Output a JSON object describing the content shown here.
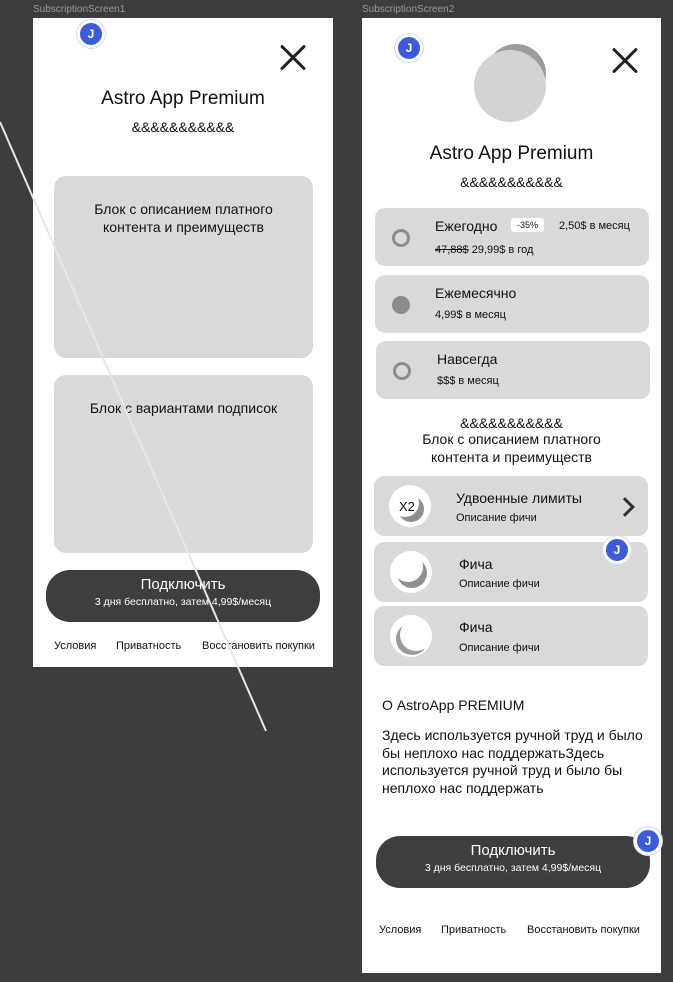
{
  "screen1": {
    "label": "SubscriptionScreen1",
    "avatar": "J",
    "title": "Astro App Premium",
    "subtitle": "&&&&&&&&&&&",
    "block_benefits": "Блок с описанием платного контента и преимуществ",
    "block_plans": "Блок с вариантами подписок",
    "cta": {
      "label": "Подключить",
      "sub": "3 дня бесплатно, затем 4,99$/месяц"
    },
    "footer": {
      "terms": "Условия",
      "privacy": "Приватность",
      "restore": "Восстановить покупки"
    }
  },
  "screen2": {
    "label": "SubscriptionScreen2",
    "avatar": "J",
    "title": "Astro App Premium",
    "subtitle": "&&&&&&&&&&&",
    "plans": [
      {
        "name": "Ежегодно",
        "badge": "-35%",
        "right": "2,50$ в месяц",
        "old_price": "47,88$",
        "price": "29,99$ в год",
        "selected": false
      },
      {
        "name": "Ежемесячно",
        "price": "4,99$ в месяц",
        "selected": true
      },
      {
        "name": "Навсегда",
        "price": "$$$ в месяц",
        "selected": false
      }
    ],
    "benefits_header": "&&&&&&&&&&&",
    "benefits_text": "Блок с описанием платного контента и преимуществ",
    "features": [
      {
        "icon_text": "X2",
        "title": "Удвоенные лимиты",
        "desc": "Описание фичи"
      },
      {
        "title": "Фича",
        "desc": "Описание фичи"
      },
      {
        "title": "Фича",
        "desc": "Описание фичи"
      }
    ],
    "about_title": "О AstroApp PREMIUM",
    "about_text": "Здесь используется ручной труд и было бы неплохо нас поддержатьЗдесь используется ручной труд и было бы неплохо нас поддержать",
    "cta": {
      "label": "Подключить",
      "sub": "3 дня бесплатно, затем 4,99$/месяц"
    },
    "footer": {
      "terms": "Условия",
      "privacy": "Приватность",
      "restore": "Восстановить покупки"
    },
    "comment_avatars": [
      "J",
      "J"
    ]
  },
  "colors": {
    "canvas": "#3d3d3d",
    "block": "#d9d9d9",
    "cta": "#3e3e3e",
    "avatar": "#3b5bdb"
  }
}
